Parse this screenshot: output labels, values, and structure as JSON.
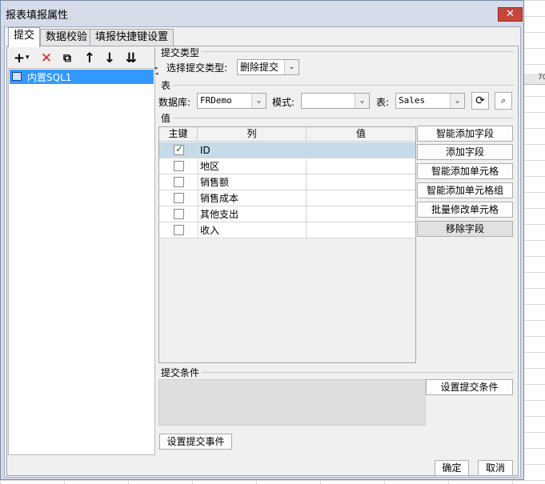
{
  "window": {
    "title": "报表填报属性",
    "close_label": "✕"
  },
  "tabs": [
    {
      "label": "提交",
      "active": true
    },
    {
      "label": "数据校验",
      "active": false
    },
    {
      "label": "填报快捷键设置",
      "active": false
    }
  ],
  "toolbar": {
    "add": "+",
    "add_dropdown": "▾",
    "delete": "✕",
    "copy": "⧉",
    "up": "↑",
    "down": "↓",
    "bottom": "⇊"
  },
  "tree": {
    "items": [
      {
        "label": "内置SQL1",
        "icon": "database-icon"
      }
    ]
  },
  "submit_type": {
    "group_label": "提交类型",
    "field_label": "选择提交类型:",
    "value": "删除提交"
  },
  "table_section": {
    "group_label": "表",
    "database_label": "数据库:",
    "database_value": "FRDemo",
    "schema_label": "模式:",
    "schema_value": "",
    "table_label": "表:",
    "table_value": "Sales"
  },
  "values_section": {
    "group_label": "值",
    "headers": [
      "主键",
      "列",
      "值"
    ],
    "rows": [
      {
        "checked": true,
        "column": "ID",
        "value": ""
      },
      {
        "checked": false,
        "column": "地区",
        "value": ""
      },
      {
        "checked": false,
        "column": "销售额",
        "value": ""
      },
      {
        "checked": false,
        "column": "销售成本",
        "value": ""
      },
      {
        "checked": false,
        "column": "其他支出",
        "value": ""
      },
      {
        "checked": false,
        "column": "收入",
        "value": ""
      }
    ],
    "buttons": [
      "智能添加字段",
      "添加字段",
      "智能添加单元格",
      "智能添加单元格组",
      "批量修改单元格",
      "移除字段"
    ]
  },
  "condition_section": {
    "group_label": "提交条件",
    "button_label": "设置提交条件"
  },
  "event_button": "设置提交事件",
  "footer": {
    "ok": "确定",
    "cancel": "取消"
  },
  "background": {
    "col_header": "70"
  },
  "colors": {
    "selection": "#3399ff",
    "close": "#c7463b",
    "dialog_frame": "#d6dbe9"
  }
}
